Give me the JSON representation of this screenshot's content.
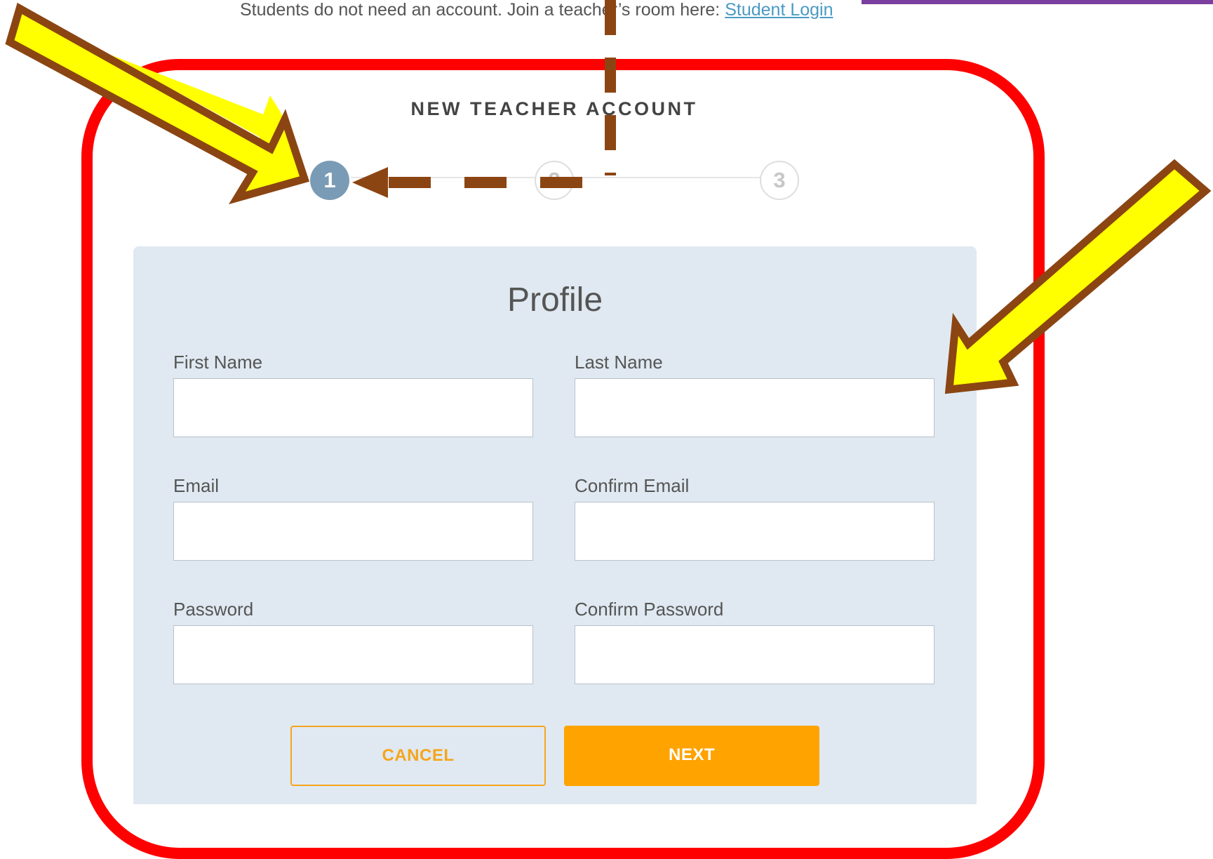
{
  "header": {
    "note_text": "Students do not need an account. Join a teacher’s room here: ",
    "student_login_link": "Student Login"
  },
  "title": "NEW TEACHER ACCOUNT",
  "stepper": {
    "steps": [
      "1",
      "2",
      "3"
    ],
    "active_step": 1
  },
  "form": {
    "section_title": "Profile",
    "fields": {
      "first_name": {
        "label": "First Name",
        "value": ""
      },
      "last_name": {
        "label": "Last Name",
        "value": ""
      },
      "email": {
        "label": "Email",
        "value": ""
      },
      "confirm_email": {
        "label": "Confirm Email",
        "value": ""
      },
      "password": {
        "label": "Password",
        "value": ""
      },
      "confirm_password": {
        "label": "Confirm Password",
        "value": ""
      }
    },
    "cancel_label": "CANCEL",
    "next_label": "NEXT"
  },
  "colors": {
    "accent_orange": "#ffa300",
    "step_active": "#7a9bb5",
    "card_background": "#e0e9f1",
    "annotation_red": "#ff0000",
    "annotation_yellow": "#ffff00",
    "annotation_brown": "#8b4513",
    "link_blue": "#4a9ac4"
  },
  "annotations": {
    "icons": [
      "yellow-arrow-icon",
      "yellow-arrow-icon",
      "dashed-arrow-icon"
    ]
  }
}
